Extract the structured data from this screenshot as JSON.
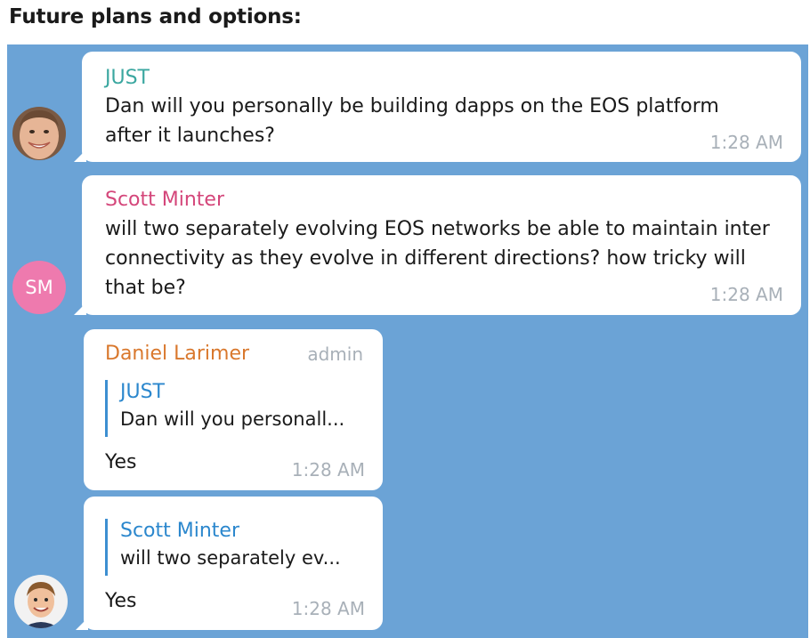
{
  "heading": "Future plans and options:",
  "colors": {
    "chat_background": "#6ba3d6",
    "bubble": "#ffffff",
    "name_just": "#3ba7a0",
    "name_scott": "#d4467a",
    "name_daniel": "#d9782d",
    "reply_accent": "#3d8fd1",
    "timestamp": "#a8b0b8",
    "avatar_sm": "#ee7aae"
  },
  "messages": [
    {
      "sender": "JUST",
      "text_lines": [
        "Dan will you personally be building dapps on the EOS platform",
        "after it launches?"
      ],
      "time": "1:28 AM",
      "avatar": "photo-face-icon"
    },
    {
      "sender": "Scott Minter",
      "avatar_initials": "SM",
      "text_lines": [
        "will two separately evolving EOS networks be able to maintain inter",
        "connectivity as they evolve in different directions? how tricky will",
        "that be?"
      ],
      "time": "1:28 AM"
    },
    {
      "sender": "Daniel Larimer",
      "role": "admin",
      "reply_to": {
        "name": "JUST",
        "text": "Dan will you personall..."
      },
      "text": "Yes",
      "time": "1:28 AM"
    },
    {
      "reply_to": {
        "name": "Scott Minter",
        "text": "will two separately ev..."
      },
      "text": "Yes",
      "time": "1:28 AM",
      "avatar": "cartoon-face-icon"
    }
  ]
}
